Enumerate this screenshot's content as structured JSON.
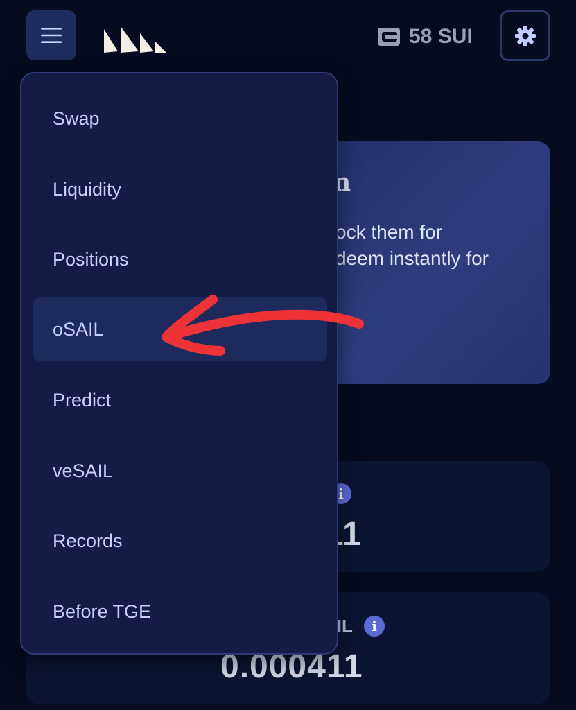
{
  "header": {
    "menu_icon": "hamburger-icon",
    "logo_icon": "sail-logo-icon",
    "wallet": {
      "icon": "wallet-icon",
      "balance": "58 SUI"
    },
    "settings_icon": "gear-icon"
  },
  "menu": {
    "items": [
      {
        "label": "Swap"
      },
      {
        "label": "Liquidity"
      },
      {
        "label": "Positions"
      },
      {
        "label": "oSAIL",
        "active": true
      },
      {
        "label": "Predict"
      },
      {
        "label": "veSAIL"
      },
      {
        "label": "Records"
      },
      {
        "label": "Before TGE"
      }
    ]
  },
  "background": {
    "promo": {
      "title_fragment": "n",
      "text_line1": "ock them for",
      "text_line2": "deem instantly for"
    },
    "stat1": {
      "value_fragment": "11",
      "info_icon": "info-icon"
    },
    "stat2": {
      "label_fragment": "AIL",
      "value": "0.000411",
      "info_icon": "info-icon"
    }
  },
  "annotation": {
    "arrow_color": "#ee3338"
  },
  "colors": {
    "background": "#070b1f",
    "menu_bg": "#141c46",
    "menu_text": "#c6ceff",
    "accent": "#5a6ad6"
  }
}
